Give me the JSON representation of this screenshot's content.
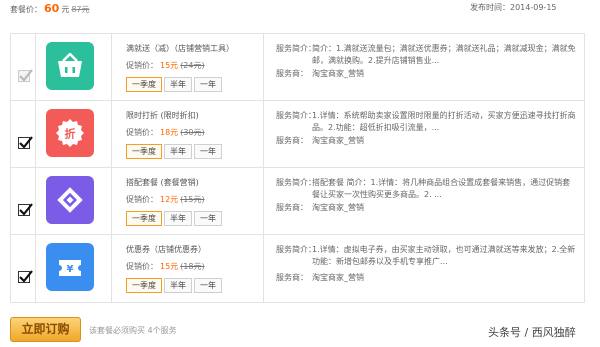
{
  "header": {
    "price_label": "套餐价：",
    "price": "60",
    "price_unit": "元",
    "original_price": "87元",
    "publish_label": "发布时间：",
    "publish_date": "2014-09-15"
  },
  "colors": {
    "accent": "#ff6600",
    "button": "#f0a828",
    "icon_green": "#2cbf9c",
    "icon_red": "#f35b58",
    "icon_purple": "#7b5ce6",
    "icon_blue": "#3a8ef0"
  },
  "items": [
    {
      "checked": true,
      "disabled": true,
      "icon": "basket-icon",
      "name": "满就送（减）（店铺营销工具）",
      "promo_label": "促销价：",
      "promo_price": "15元",
      "orig_price": "(24元)",
      "periods": [
        "一季度",
        "半年",
        "一年"
      ],
      "desc_label": "服务简介：",
      "desc_text": "简介：1.满就送流量包；满就送优惠券；满就送礼品；满就减现金；满就免邮，满就换购。2.提升店铺销售业...",
      "biz_label": "服务商：",
      "biz_text": "淘宝商家_营销"
    },
    {
      "checked": true,
      "disabled": false,
      "icon": "discount-icon",
      "name": "限时打折 (限时折扣)",
      "promo_label": "促销价：",
      "promo_price": "18元",
      "orig_price": "(30元)",
      "periods": [
        "一季度",
        "半年",
        "一年"
      ],
      "desc_label": "服务简介：",
      "desc_text": "1.详情：系统帮助卖家设置限时限量的打折活动，买家方便迅速寻找打折商品。2.功能：超低折扣吸引流量，...",
      "biz_label": "服务商：",
      "biz_text": "淘宝商家_营销"
    },
    {
      "checked": true,
      "disabled": false,
      "icon": "bundle-icon",
      "name": "搭配套餐 (套餐营销)",
      "promo_label": "促销价：",
      "promo_price": "12元",
      "orig_price": "(15元)",
      "periods": [
        "一季度",
        "半年",
        "一年"
      ],
      "desc_label": "服务简介：",
      "desc_text": "搭配套餐 简介：1.详情：将几种商品组合设置成套餐来销售，通过促销套餐让买家一次性购买更多商品。2. ...",
      "biz_label": "服务商：",
      "biz_text": "淘宝商家_营销"
    },
    {
      "checked": true,
      "disabled": false,
      "icon": "coupon-icon",
      "name": "优惠券（店铺优惠券）",
      "promo_label": "促销价：",
      "promo_price": "15元",
      "orig_price": "(18元)",
      "periods": [
        "一季度",
        "半年",
        "一年"
      ],
      "desc_label": "服务简介：",
      "desc_text": "1.详情：虚拟电子券，由买家主动领取，也可通过满就送等来发放；2.全新功能：新增包邮券以及手机专享推广...",
      "biz_label": "服务商：",
      "biz_text": "淘宝商家_营销"
    }
  ],
  "footer": {
    "buy_label": "立即订购",
    "note": "该套餐必须购买 4个服务",
    "watermark": "头条号 / 西风独醉"
  }
}
